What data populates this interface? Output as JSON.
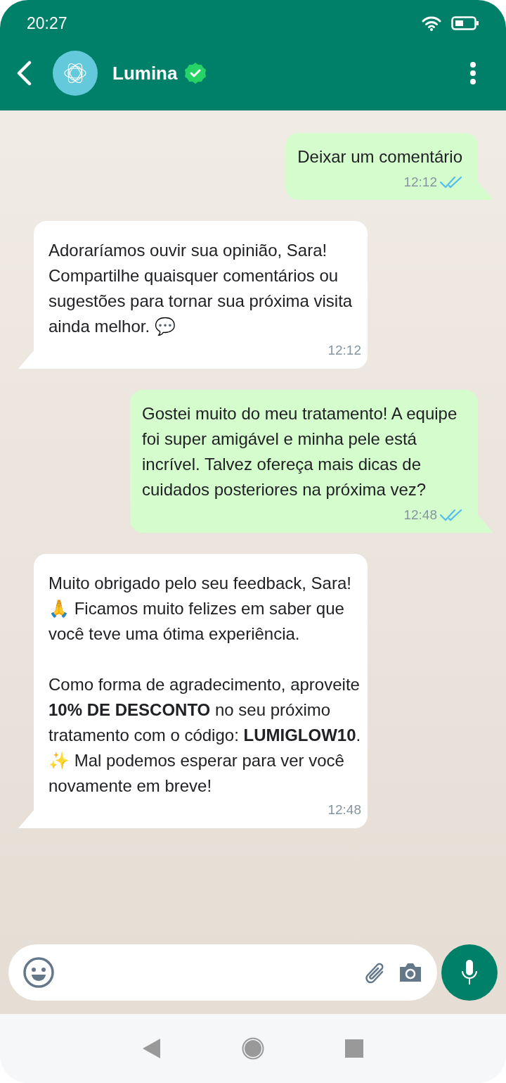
{
  "status_bar": {
    "time": "20:27"
  },
  "header": {
    "contact_name": "Lumina",
    "verified": true
  },
  "messages": [
    {
      "kind": "outgoing",
      "text": "Deixar um comentário",
      "time": "12:12",
      "read": true
    },
    {
      "kind": "incoming",
      "text": "Adoraríamos ouvir sua opinião, Sara! Compartilhe quaisquer comentários ou sugestões para tornar sua próxima visita ainda melhor. 💬",
      "time": "12:12"
    },
    {
      "kind": "outgoing",
      "text": "Gostei muito do meu tratamento! A equipe foi super amigável e minha pele está incrível. Talvez ofereça mais dicas de cuidados posteriores na próxima vez?",
      "time": "12:48",
      "read": true
    },
    {
      "kind": "incoming",
      "text": "Muito obrigado pelo seu feedback, Sara! 🙏 Ficamos muito felizes em saber que você teve uma ótima experiência.\n\nComo forma de agradecimento, aproveite **10% DE DESCONTO** no seu próximo tratamento com o código: **LUMIGLOW10**. ✨ Mal podemos esperar para ver você novamente em breve!",
      "time": "12:48"
    }
  ]
}
